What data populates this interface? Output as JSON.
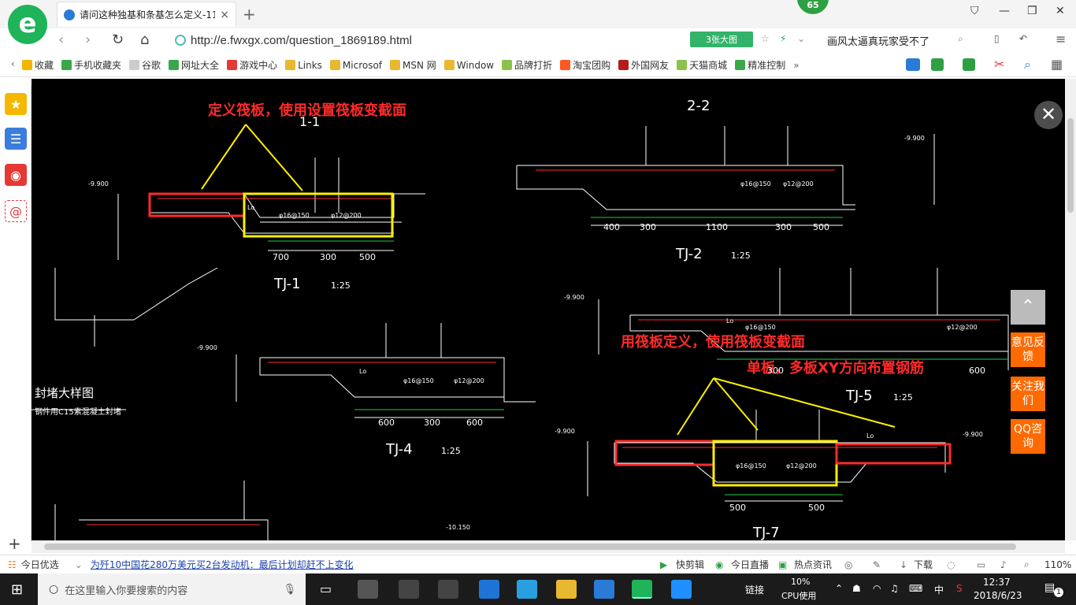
{
  "browser": {
    "tab_title": "请问这种独基和条基怎么定义-11",
    "tab_close": "×",
    "new_tab": "+",
    "score_badge": "65",
    "url": "http://e.fwxgx.com/question_1869189.html",
    "big_pic_label": "3张大图",
    "news_ticker": "画风太逼真玩家受不了"
  },
  "bookmarks": [
    {
      "label": "收藏",
      "color": "#f4b400"
    },
    {
      "label": "手机收藏夹",
      "color": "#3aa74a"
    },
    {
      "label": "谷歌",
      "color": "#cccccc"
    },
    {
      "label": "网址大全",
      "color": "#3aa74a"
    },
    {
      "label": "游戏中心",
      "color": "#e53935"
    },
    {
      "label": "Links",
      "color": "#e8b830"
    },
    {
      "label": "Microsof",
      "color": "#e8b830"
    },
    {
      "label": "MSN 网",
      "color": "#e8b830"
    },
    {
      "label": "Window",
      "color": "#e8b830"
    },
    {
      "label": "品牌打折",
      "color": "#8bc34a"
    },
    {
      "label": "淘宝团购",
      "color": "#ff5722"
    },
    {
      "label": "外国网友",
      "color": "#b71c1c"
    },
    {
      "label": "天猫商城",
      "color": "#8bc34a"
    },
    {
      "label": "精准控制",
      "color": "#3aa74a"
    }
  ],
  "bookmark_more": "»",
  "drawing": {
    "annotation_1": "定义筏板，使用设置筏板变截面",
    "annotation_2": "用筏板定义，使用筏板变截面",
    "annotation_3": "单板，多板XY方向布置钢筋",
    "label_22": "2-2",
    "label_11": "1-1",
    "tj1": "TJ-1",
    "tj1_scale": "1:25",
    "tj2": "TJ-2",
    "tj2_scale": "1:25",
    "tj4": "TJ-4",
    "tj4_scale": "1:25",
    "tj5": "TJ-5",
    "tj5_scale": "1:25",
    "tj7": "TJ-7",
    "seal_title": "封堵大样图",
    "seal_sub": "钢件用C15素混凝土封堵",
    "dims_tj1": [
      "700",
      "300",
      "500"
    ],
    "dims_tj2": [
      "400",
      "300",
      "1100",
      "300",
      "500"
    ],
    "dims_tj4": [
      "600",
      "300",
      "600"
    ],
    "dims_tj5": [
      "300",
      "600"
    ],
    "dims_tj7": [
      "500",
      "500"
    ],
    "elev_left": "-9.900",
    "elev_right": "-9.900",
    "elev_low": "-10.150",
    "rebar_1": "φ16@150",
    "rebar_2": "φ12@200",
    "lo": "Lo"
  },
  "float_buttons": {
    "feedback": "意见反馈",
    "follow": "关注我们",
    "qq": "QQ咨询"
  },
  "statusbar": {
    "today": "今日优选",
    "headline": "为歼10中国花280万美元买2台发动机：最后计划却赶不上变化",
    "clip": "快剪辑",
    "live": "今日直播",
    "hot": "热点资讯",
    "download": "下载",
    "zoom": "110%"
  },
  "taskbar": {
    "search_placeholder": "在这里输入你要搜索的内容",
    "link": "链接",
    "cpu_pct": "10%",
    "cpu_label": "CPU使用",
    "ime": "中",
    "time": "12:37",
    "date": "2018/6/23",
    "notify_count": "1"
  },
  "colors": {
    "accent_green": "#1fb35a",
    "annotation_red": "#ff2a2a",
    "highlight_yellow": "#ffee00",
    "float_orange": "#ff6a00"
  }
}
